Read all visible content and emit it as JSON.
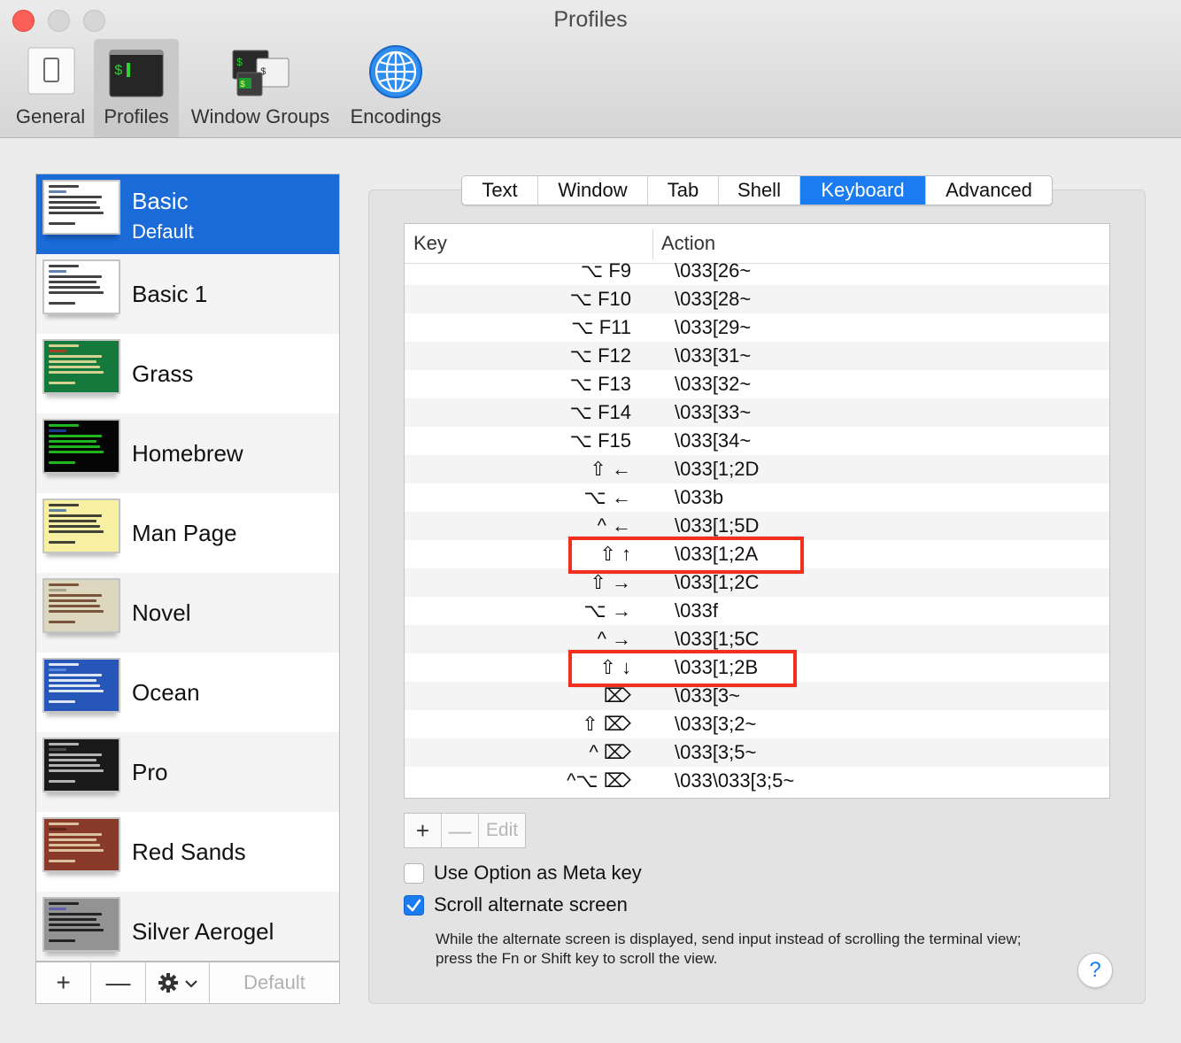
{
  "window": {
    "title": "Profiles"
  },
  "toolbar": [
    {
      "label": "General",
      "icon": "general-icon",
      "selected": false
    },
    {
      "label": "Profiles",
      "icon": "terminal-profile-icon",
      "selected": true
    },
    {
      "label": "Window Groups",
      "icon": "window-groups-icon",
      "selected": false
    },
    {
      "label": "Encodings",
      "icon": "globe-icon",
      "selected": false
    }
  ],
  "icon_text": {
    "prompt": "$"
  },
  "profiles": [
    {
      "name": "Basic",
      "subtitle": "Default",
      "selected": true,
      "bg": "#ffffff",
      "fg": "#222222",
      "hl": "#4a6fa5"
    },
    {
      "name": "Basic 1",
      "subtitle": "",
      "selected": false,
      "bg": "#ffffff",
      "fg": "#222222",
      "hl": "#4a6fa5"
    },
    {
      "name": "Grass",
      "subtitle": "",
      "selected": false,
      "bg": "#14793a",
      "fg": "#f4e2a0",
      "hl": "#b83a22"
    },
    {
      "name": "Homebrew",
      "subtitle": "",
      "selected": false,
      "bg": "#050505",
      "fg": "#27d427",
      "hl": "#2244aa"
    },
    {
      "name": "Man Page",
      "subtitle": "",
      "selected": false,
      "bg": "#f7efa2",
      "fg": "#222222",
      "hl": "#4a6fa5"
    },
    {
      "name": "Novel",
      "subtitle": "",
      "selected": false,
      "bg": "#ded7c0",
      "fg": "#6a3e23",
      "hl": "#9f9a83"
    },
    {
      "name": "Ocean",
      "subtitle": "",
      "selected": false,
      "bg": "#2656b8",
      "fg": "#ffffff",
      "hl": "#5f8fe0"
    },
    {
      "name": "Pro",
      "subtitle": "",
      "selected": false,
      "bg": "#1a1a1a",
      "fg": "#cfcfcf",
      "hl": "#555555"
    },
    {
      "name": "Red Sands",
      "subtitle": "",
      "selected": false,
      "bg": "#8a3a2a",
      "fg": "#e9d9b0",
      "hl": "#5a2418"
    },
    {
      "name": "Silver Aerogel",
      "subtitle": "",
      "selected": false,
      "bg": "#939393",
      "fg": "#101010",
      "hl": "#5a5ab0"
    }
  ],
  "list_actions": {
    "add": "+",
    "remove": "—",
    "gear_icon": "gear-icon",
    "chevron": "⌄",
    "default": "Default"
  },
  "tabs": [
    {
      "label": "Text",
      "active": false
    },
    {
      "label": "Window",
      "active": false
    },
    {
      "label": "Tab",
      "active": false
    },
    {
      "label": "Shell",
      "active": false
    },
    {
      "label": "Keyboard",
      "active": true
    },
    {
      "label": "Advanced",
      "active": false
    }
  ],
  "keymap": {
    "col_key": "Key",
    "col_action": "Action",
    "rows": [
      {
        "key": "⌥ F9",
        "action": "\\033[26~",
        "highlighted": false
      },
      {
        "key": "⌥ F10",
        "action": "\\033[28~",
        "highlighted": false
      },
      {
        "key": "⌥ F11",
        "action": "\\033[29~",
        "highlighted": false
      },
      {
        "key": "⌥ F12",
        "action": "\\033[31~",
        "highlighted": false
      },
      {
        "key": "⌥ F13",
        "action": "\\033[32~",
        "highlighted": false
      },
      {
        "key": "⌥ F14",
        "action": "\\033[33~",
        "highlighted": false
      },
      {
        "key": "⌥ F15",
        "action": "\\033[34~",
        "highlighted": false
      },
      {
        "key": "⇧ ←",
        "action": "\\033[1;2D",
        "highlighted": false
      },
      {
        "key": "⌥ ←",
        "action": "\\033b",
        "highlighted": false
      },
      {
        "key": "^ ←",
        "action": "\\033[1;5D",
        "highlighted": false
      },
      {
        "key": "⇧ ↑",
        "action": "\\033[1;2A",
        "highlighted": true
      },
      {
        "key": "⇧ →",
        "action": "\\033[1;2C",
        "highlighted": false
      },
      {
        "key": "⌥ →",
        "action": "\\033f",
        "highlighted": false
      },
      {
        "key": "^ →",
        "action": "\\033[1;5C",
        "highlighted": false
      },
      {
        "key": "⇧ ↓",
        "action": "\\033[1;2B",
        "highlighted": true
      },
      {
        "key": "⌦",
        "action": "\\033[3~",
        "highlighted": false
      },
      {
        "key": "⇧ ⌦",
        "action": "\\033[3;2~",
        "highlighted": false
      },
      {
        "key": "^ ⌦",
        "action": "\\033[3;5~",
        "highlighted": false
      },
      {
        "key": "^⌥ ⌦",
        "action": "\\033\\033[3;5~",
        "highlighted": false
      }
    ]
  },
  "table_actions": {
    "add": "+",
    "remove": "—",
    "edit": "Edit"
  },
  "options": {
    "meta_label": "Use Option as Meta key",
    "meta_checked": false,
    "scroll_label": "Scroll alternate screen",
    "scroll_checked": true,
    "description": "While the alternate screen is displayed, send input instead of scrolling the terminal view; press the Fn or Shift key to scroll the view."
  },
  "help": "?",
  "colors": {
    "accent": "#1a7cf0",
    "selection": "#1a6ad8",
    "highlight_box": "#f2301f"
  }
}
